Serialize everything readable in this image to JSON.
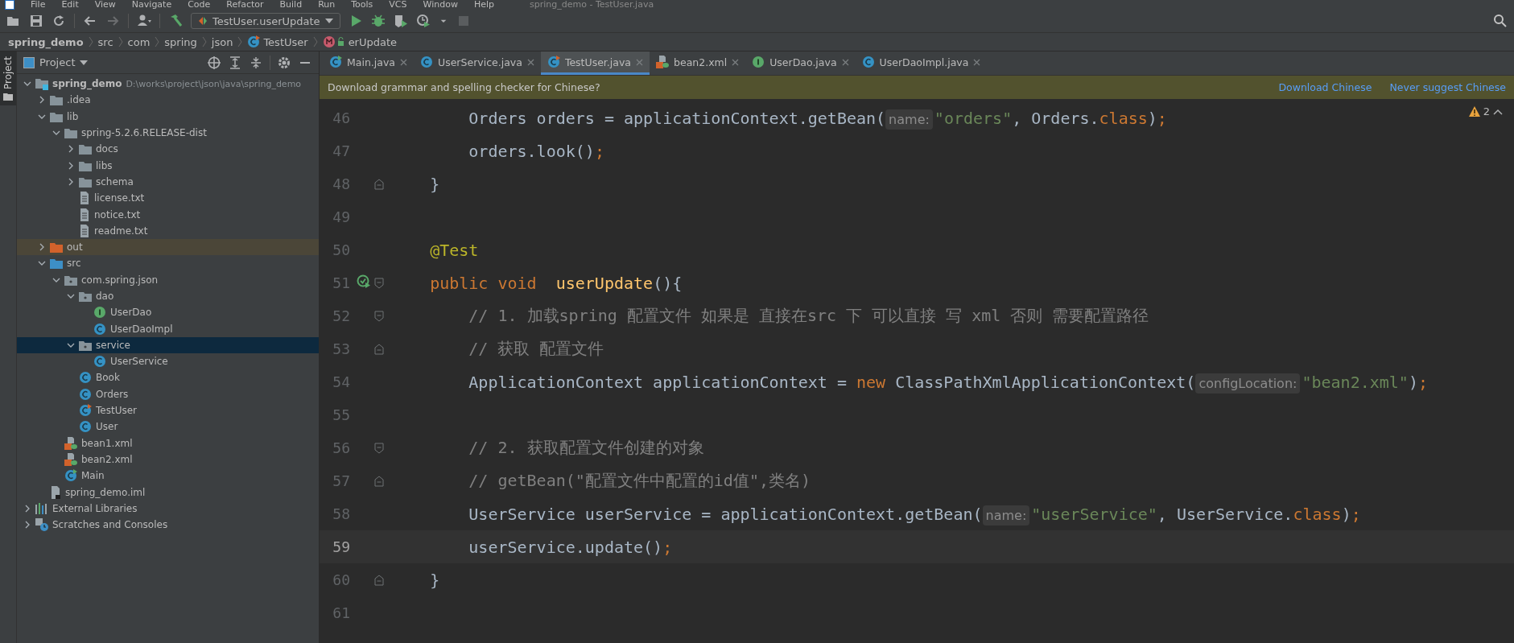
{
  "menu_bar": {
    "items": [
      "File",
      "Edit",
      "View",
      "Navigate",
      "Code",
      "Refactor",
      "Build",
      "Run",
      "Tools",
      "VCS",
      "Window",
      "Help"
    ],
    "title": "spring_demo - TestUser.java"
  },
  "toolbar": {
    "run_configuration": "TestUser.userUpdate"
  },
  "breadcrumbs": [
    {
      "label": "spring_demo",
      "kind": "project"
    },
    {
      "label": "src",
      "kind": "folder"
    },
    {
      "label": "com",
      "kind": "folder"
    },
    {
      "label": "spring",
      "kind": "folder"
    },
    {
      "label": "json",
      "kind": "folder"
    },
    {
      "label": "TestUser",
      "kind": "class"
    },
    {
      "label": "erUpdate",
      "kind": "method"
    }
  ],
  "tool_strip": {
    "label": "Project",
    "selected": true
  },
  "project_panel": {
    "title": "Project",
    "tree": [
      {
        "label": "spring_demo",
        "path": "D:\\works\\project\\json\\java\\spring_demo",
        "kind": "module",
        "expanded": true,
        "selected": false,
        "children": [
          {
            "label": ".idea",
            "kind": "folder",
            "expanded": false,
            "selected": false
          },
          {
            "label": "lib",
            "kind": "folder",
            "expanded": true,
            "selected": false,
            "children": [
              {
                "label": "spring-5.2.6.RELEASE-dist",
                "kind": "folder",
                "expanded": true,
                "selected": false,
                "children": [
                  {
                    "label": "docs",
                    "kind": "folder",
                    "expanded": false,
                    "selected": false
                  },
                  {
                    "label": "libs",
                    "kind": "folder",
                    "expanded": false,
                    "selected": false
                  },
                  {
                    "label": "schema",
                    "kind": "folder",
                    "expanded": false,
                    "selected": false
                  },
                  {
                    "label": "license.txt",
                    "kind": "text",
                    "selected": false
                  },
                  {
                    "label": "notice.txt",
                    "kind": "text",
                    "selected": false
                  },
                  {
                    "label": "readme.txt",
                    "kind": "text",
                    "selected": false
                  }
                ]
              }
            ]
          },
          {
            "label": "out",
            "kind": "excluded",
            "expanded": false,
            "selected": false
          },
          {
            "label": "src",
            "kind": "source",
            "expanded": true,
            "selected": false,
            "children": [
              {
                "label": "com.spring.json",
                "kind": "package",
                "expanded": true,
                "selected": false,
                "children": [
                  {
                    "label": "dao",
                    "kind": "package",
                    "expanded": true,
                    "selected": false,
                    "children": [
                      {
                        "label": "UserDao",
                        "kind": "interface",
                        "selected": false
                      },
                      {
                        "label": "UserDaoImpl",
                        "kind": "class",
                        "selected": false
                      }
                    ]
                  },
                  {
                    "label": "service",
                    "kind": "package",
                    "expanded": true,
                    "selected": true,
                    "children": [
                      {
                        "label": "UserService",
                        "kind": "class",
                        "selected": false
                      }
                    ]
                  },
                  {
                    "label": "Book",
                    "kind": "class",
                    "selected": false
                  },
                  {
                    "label": "Orders",
                    "kind": "class",
                    "selected": false
                  },
                  {
                    "label": "TestUser",
                    "kind": "test",
                    "selected": false
                  },
                  {
                    "label": "User",
                    "kind": "class",
                    "selected": false
                  }
                ]
              },
              {
                "label": "bean1.xml",
                "kind": "xml",
                "selected": false
              },
              {
                "label": "bean2.xml",
                "kind": "xml",
                "selected": false
              },
              {
                "label": "Main",
                "kind": "main",
                "selected": false
              }
            ]
          },
          {
            "label": "spring_demo.iml",
            "kind": "iml",
            "selected": false
          }
        ]
      },
      {
        "label": "External Libraries",
        "kind": "libraries",
        "expanded": false,
        "selected": false
      },
      {
        "label": "Scratches and Consoles",
        "kind": "scratches",
        "expanded": false,
        "selected": false
      }
    ]
  },
  "editor_tabs": [
    {
      "label": "Main.java",
      "kind": "main",
      "selected": false
    },
    {
      "label": "UserService.java",
      "kind": "class",
      "selected": false
    },
    {
      "label": "TestUser.java",
      "kind": "test",
      "selected": true
    },
    {
      "label": "bean2.xml",
      "kind": "xml",
      "selected": false
    },
    {
      "label": "UserDao.java",
      "kind": "interface",
      "selected": false
    },
    {
      "label": "UserDaoImpl.java",
      "kind": "class",
      "selected": false
    }
  ],
  "notification": {
    "message": "Download grammar and spelling checker for Chinese?",
    "actions": [
      "Download Chinese",
      "Never suggest Chinese"
    ]
  },
  "inspections": {
    "warnings": "2"
  },
  "code_lines": [
    {
      "number": "46",
      "current": false,
      "tokens": [
        {
          "kind": "plain",
          "text": "        Orders orders = applicationContext.getBean("
        },
        {
          "kind": "hint",
          "text": "name:"
        },
        {
          "kind": "string",
          "text": "\"orders\""
        },
        {
          "kind": "plain",
          "text": ", Orders."
        },
        {
          "kind": "keyword",
          "text": "class"
        },
        {
          "kind": "plain",
          "text": ")"
        },
        {
          "kind": "keyword",
          "text": ";"
        }
      ]
    },
    {
      "number": "47",
      "current": false,
      "tokens": [
        {
          "kind": "plain",
          "text": "        orders.look()"
        },
        {
          "kind": "keyword",
          "text": ";"
        }
      ]
    },
    {
      "number": "48",
      "current": false,
      "fold_end": true,
      "tokens": [
        {
          "kind": "plain",
          "text": "    }"
        }
      ]
    },
    {
      "number": "49",
      "current": false
    },
    {
      "number": "50",
      "current": false,
      "tokens": [
        {
          "kind": "annotation",
          "text": "    @Test"
        }
      ]
    },
    {
      "number": "51",
      "current": false,
      "run_test": true,
      "fold_start": true,
      "tokens": [
        {
          "kind": "keyword",
          "text": "    public void  "
        },
        {
          "kind": "method",
          "text": "userUpdate"
        },
        {
          "kind": "plain",
          "text": "(){"
        }
      ]
    },
    {
      "number": "52",
      "current": false,
      "fold_start": true,
      "tokens": [
        {
          "kind": "comment",
          "text": "        // 1. 加载spring 配置文件 如果是 直接在src 下 可以直接 写 xml 否则 需要配置路径"
        }
      ]
    },
    {
      "number": "53",
      "current": false,
      "fold_end": true,
      "tokens": [
        {
          "kind": "comment",
          "text": "        // 获取 配置文件"
        }
      ]
    },
    {
      "number": "54",
      "current": false,
      "tokens": [
        {
          "kind": "plain",
          "text": "        ApplicationContext applicationContext = "
        },
        {
          "kind": "keyword",
          "text": "new"
        },
        {
          "kind": "plain",
          "text": " ClassPathXmlApplicationContext("
        },
        {
          "kind": "hint",
          "text": "configLocation:"
        },
        {
          "kind": "string",
          "text": "\"bean2.xml\""
        },
        {
          "kind": "plain",
          "text": ")"
        },
        {
          "kind": "keyword",
          "text": ";"
        }
      ]
    },
    {
      "number": "55",
      "current": false
    },
    {
      "number": "56",
      "current": false,
      "fold_start": true,
      "tokens": [
        {
          "kind": "comment",
          "text": "        // 2. 获取配置文件创建的对象"
        }
      ]
    },
    {
      "number": "57",
      "current": false,
      "fold_end": true,
      "tokens": [
        {
          "kind": "comment",
          "text": "        // getBean(\"配置文件中配置的id值\",类名)"
        }
      ]
    },
    {
      "number": "58",
      "current": false,
      "tokens": [
        {
          "kind": "plain",
          "text": "        UserService userService = applicationContext.getBean("
        },
        {
          "kind": "hint",
          "text": "name:"
        },
        {
          "kind": "string",
          "text": "\"userService\""
        },
        {
          "kind": "plain",
          "text": ", UserService."
        },
        {
          "kind": "keyword",
          "text": "class"
        },
        {
          "kind": "plain",
          "text": ")"
        },
        {
          "kind": "keyword",
          "text": ";"
        }
      ]
    },
    {
      "number": "59",
      "current": true,
      "tokens": [
        {
          "kind": "plain",
          "text": "        userService.update()"
        },
        {
          "kind": "keyword",
          "text": ";"
        }
      ]
    },
    {
      "number": "60",
      "current": false,
      "fold_end": true,
      "tokens": [
        {
          "kind": "plain",
          "text": "    }"
        }
      ]
    },
    {
      "number": "61",
      "current": false
    }
  ]
}
